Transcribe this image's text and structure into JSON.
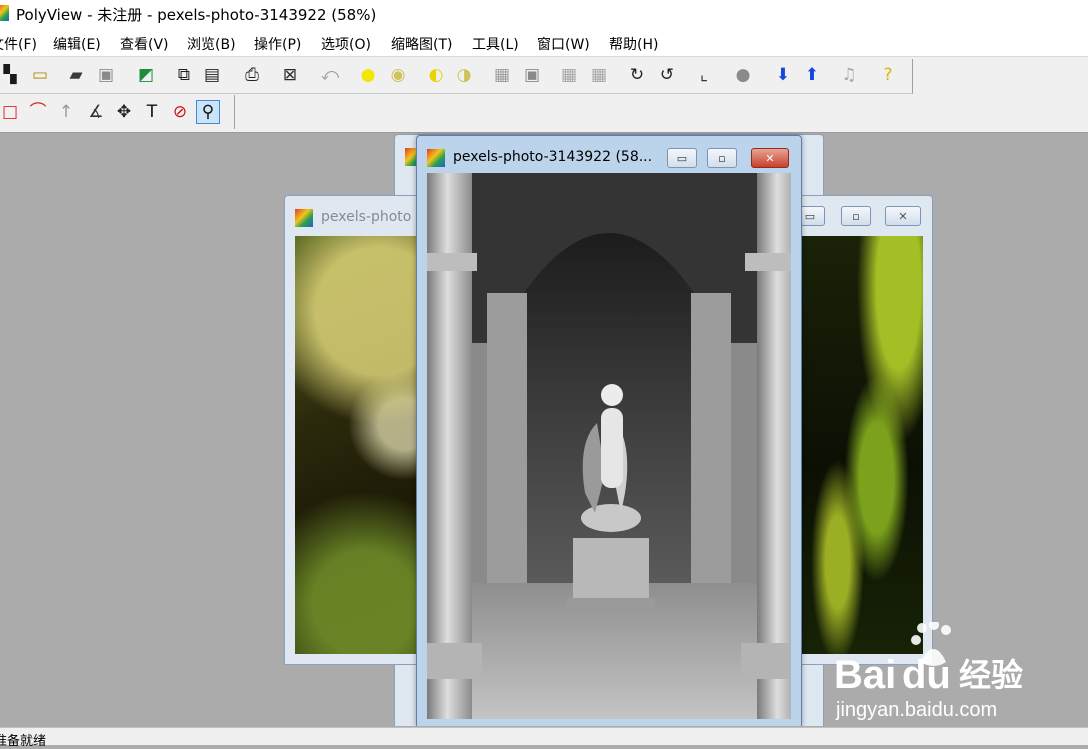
{
  "window": {
    "title": "PolyView - 未注册 - pexels-photo-3143922 (58%)"
  },
  "menu": {
    "items": [
      {
        "label": "文件(F)"
      },
      {
        "label": "编辑(E)"
      },
      {
        "label": "查看(V)"
      },
      {
        "label": "浏览(B)"
      },
      {
        "label": "操作(P)"
      },
      {
        "label": "选项(O)"
      },
      {
        "label": "缩略图(T)"
      },
      {
        "label": "工具(L)"
      },
      {
        "label": "窗口(W)"
      },
      {
        "label": "帮助(H)"
      }
    ]
  },
  "toolbar_main": {
    "buttons": [
      {
        "name": "scanner-icon",
        "glyph": "▚",
        "color": "#1a1a1a"
      },
      {
        "name": "new-icon",
        "glyph": "▭",
        "color": "#b58a16"
      },
      {
        "name": "open-folder-icon",
        "glyph": "▰",
        "color": "#3a3a3a"
      },
      {
        "name": "save-icon",
        "glyph": "▣",
        "color": "#8a8a8a"
      },
      {
        "name": "image-icon",
        "glyph": "◩",
        "color": "#1d8d3a"
      },
      {
        "name": "copy-icon",
        "glyph": "⧉",
        "color": "#222222"
      },
      {
        "name": "paste-icon",
        "glyph": "▤",
        "color": "#222222"
      },
      {
        "name": "print-icon",
        "glyph": "⎙",
        "color": "#222222"
      },
      {
        "name": "fit-screen-icon",
        "glyph": "⊠",
        "color": "#2a2a2a"
      },
      {
        "name": "undo-icon",
        "glyph": "⤺",
        "color": "#9a9a9a"
      },
      {
        "name": "brightness-up-icon",
        "glyph": "●",
        "color": "#f3e600"
      },
      {
        "name": "brightness-down-icon",
        "glyph": "◉",
        "color": "#cfc25a"
      },
      {
        "name": "contrast-up-icon",
        "glyph": "◐",
        "color": "#e8d400"
      },
      {
        "name": "contrast-down-icon",
        "glyph": "◑",
        "color": "#cfc25a"
      },
      {
        "name": "gray-pattern-icon",
        "glyph": "▦",
        "color": "#9a9a9a"
      },
      {
        "name": "frame-icon",
        "glyph": "▣",
        "color": "#8a8a8a"
      },
      {
        "name": "gray-square-icon",
        "glyph": "▦",
        "color": "#a4a4a4"
      },
      {
        "name": "gray-square-2-icon",
        "glyph": "▦",
        "color": "#a4a4a4"
      },
      {
        "name": "rotate-right-icon",
        "glyph": "↻",
        "color": "#222222"
      },
      {
        "name": "rotate-left-icon",
        "glyph": "↺",
        "color": "#222222"
      },
      {
        "name": "crop-icon",
        "glyph": "⌞",
        "color": "#333333"
      },
      {
        "name": "warning-icon",
        "glyph": "●",
        "color": "#8a8a8a"
      },
      {
        "name": "arrow-down-icon",
        "glyph": "⬇",
        "color": "#1446e0"
      },
      {
        "name": "arrow-up-icon",
        "glyph": "⬆",
        "color": "#1446e0"
      },
      {
        "name": "music-icon",
        "glyph": "♫",
        "color": "#a8a8a8"
      },
      {
        "name": "help-icon",
        "glyph": "?",
        "color": "#d8b800"
      }
    ]
  },
  "toolbar_tools": {
    "buttons": [
      {
        "name": "rect-select-icon",
        "glyph": "□",
        "color": "#e02020"
      },
      {
        "name": "lasso-icon",
        "glyph": "⌒",
        "color": "#e02020"
      },
      {
        "name": "arrow-tool-icon",
        "glyph": "↑",
        "color": "#9a9a9a"
      },
      {
        "name": "angle-tool-icon",
        "glyph": "∡",
        "color": "#333333"
      },
      {
        "name": "move-icon",
        "glyph": "✥",
        "color": "#222222"
      },
      {
        "name": "text-tool-icon",
        "glyph": "T",
        "color": "#111111"
      },
      {
        "name": "no-entry-icon",
        "glyph": "⊘",
        "color": "#d01010"
      },
      {
        "name": "zoom-icon",
        "glyph": "⚲",
        "color": "#111111"
      }
    ]
  },
  "documents": {
    "left": {
      "title": "pexels-photo"
    },
    "active": {
      "title": "pexels-photo-3143922 (58..."
    },
    "buttons": {
      "minimize": "▭",
      "restore": "▫",
      "close": "✕"
    }
  },
  "status": {
    "text": "准备就绪"
  },
  "watermark": {
    "brand_left": "Bai",
    "brand_right": "du",
    "brand_cn": "经验",
    "url": "jingyan.baidu.com"
  },
  "colors": {
    "workspace": "#ababab",
    "active_frame": "#bcd3ec",
    "close_red": "#c7412b",
    "baidu_red": "#d8392b"
  }
}
